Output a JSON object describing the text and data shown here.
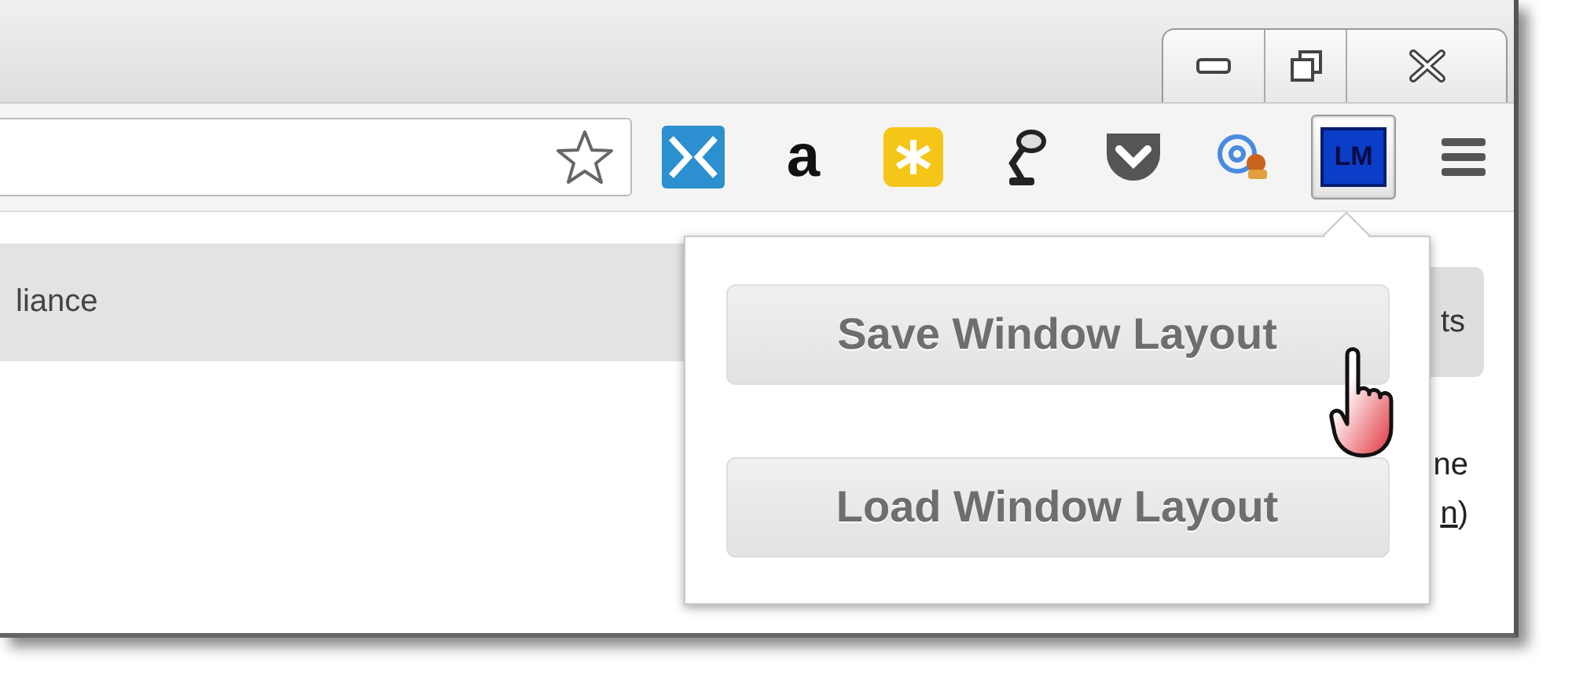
{
  "window_controls": [
    {
      "kind": "minimize"
    },
    {
      "kind": "restore"
    },
    {
      "kind": "close"
    }
  ],
  "address_bar": {
    "bookmarked": false
  },
  "extensions": [
    {
      "kind": "split",
      "selected": false
    },
    {
      "kind": "letter",
      "label": "a",
      "selected": false
    },
    {
      "kind": "asterisk",
      "selected": false
    },
    {
      "kind": "lamp",
      "selected": false
    },
    {
      "kind": "pocket",
      "selected": false
    },
    {
      "kind": "email",
      "selected": false
    },
    {
      "kind": "badge",
      "label": "LM",
      "selected": true
    },
    {
      "kind": "menu",
      "selected": false
    }
  ],
  "page": {
    "banner_text": "liance",
    "button_text": "ts",
    "side_text": "ne",
    "link_text": "n",
    "after_link": ")"
  },
  "popup": {
    "buttons": [
      {
        "label": "Save Window Layout"
      },
      {
        "label": "Load Window Layout"
      }
    ]
  }
}
